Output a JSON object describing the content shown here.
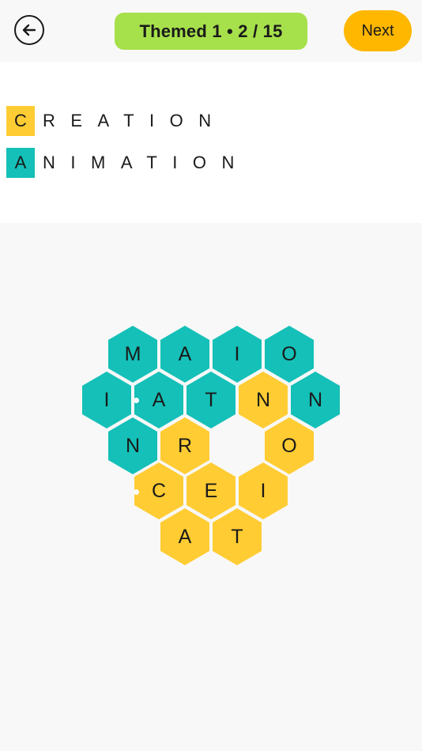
{
  "colors": {
    "background": "#f8f8f8",
    "panel": "#ffffff",
    "teal": "#14c0b7",
    "yellow": "#ffcc33",
    "pill_green": "#a6e04b",
    "next_orange": "#ffb700"
  },
  "header": {
    "back_icon": "arrow-left-icon",
    "level_label": "Themed 1 • 2 / 15",
    "next_label": "Next"
  },
  "words": [
    {
      "first": "C",
      "rest": "REATION",
      "color": "#ffcc33"
    },
    {
      "first": "A",
      "rest": "NIMATION",
      "color": "#14c0b7"
    }
  ],
  "board": {
    "tiles": [
      {
        "letter": "M",
        "color": "teal"
      },
      {
        "letter": "A",
        "color": "teal"
      },
      {
        "letter": "I",
        "color": "teal"
      },
      {
        "letter": "O",
        "color": "teal"
      },
      {
        "letter": "I",
        "color": "teal"
      },
      {
        "letter": "A",
        "color": "teal"
      },
      {
        "letter": "T",
        "color": "teal"
      },
      {
        "letter": "N",
        "color": "yellow"
      },
      {
        "letter": "N",
        "color": "teal"
      },
      {
        "letter": "N",
        "color": "teal"
      },
      {
        "letter": "R",
        "color": "yellow"
      },
      {
        "letter": "O",
        "color": "yellow"
      },
      {
        "letter": "C",
        "color": "yellow"
      },
      {
        "letter": "E",
        "color": "yellow"
      },
      {
        "letter": "I",
        "color": "yellow"
      },
      {
        "letter": "A",
        "color": "yellow"
      },
      {
        "letter": "T",
        "color": "yellow"
      }
    ]
  }
}
